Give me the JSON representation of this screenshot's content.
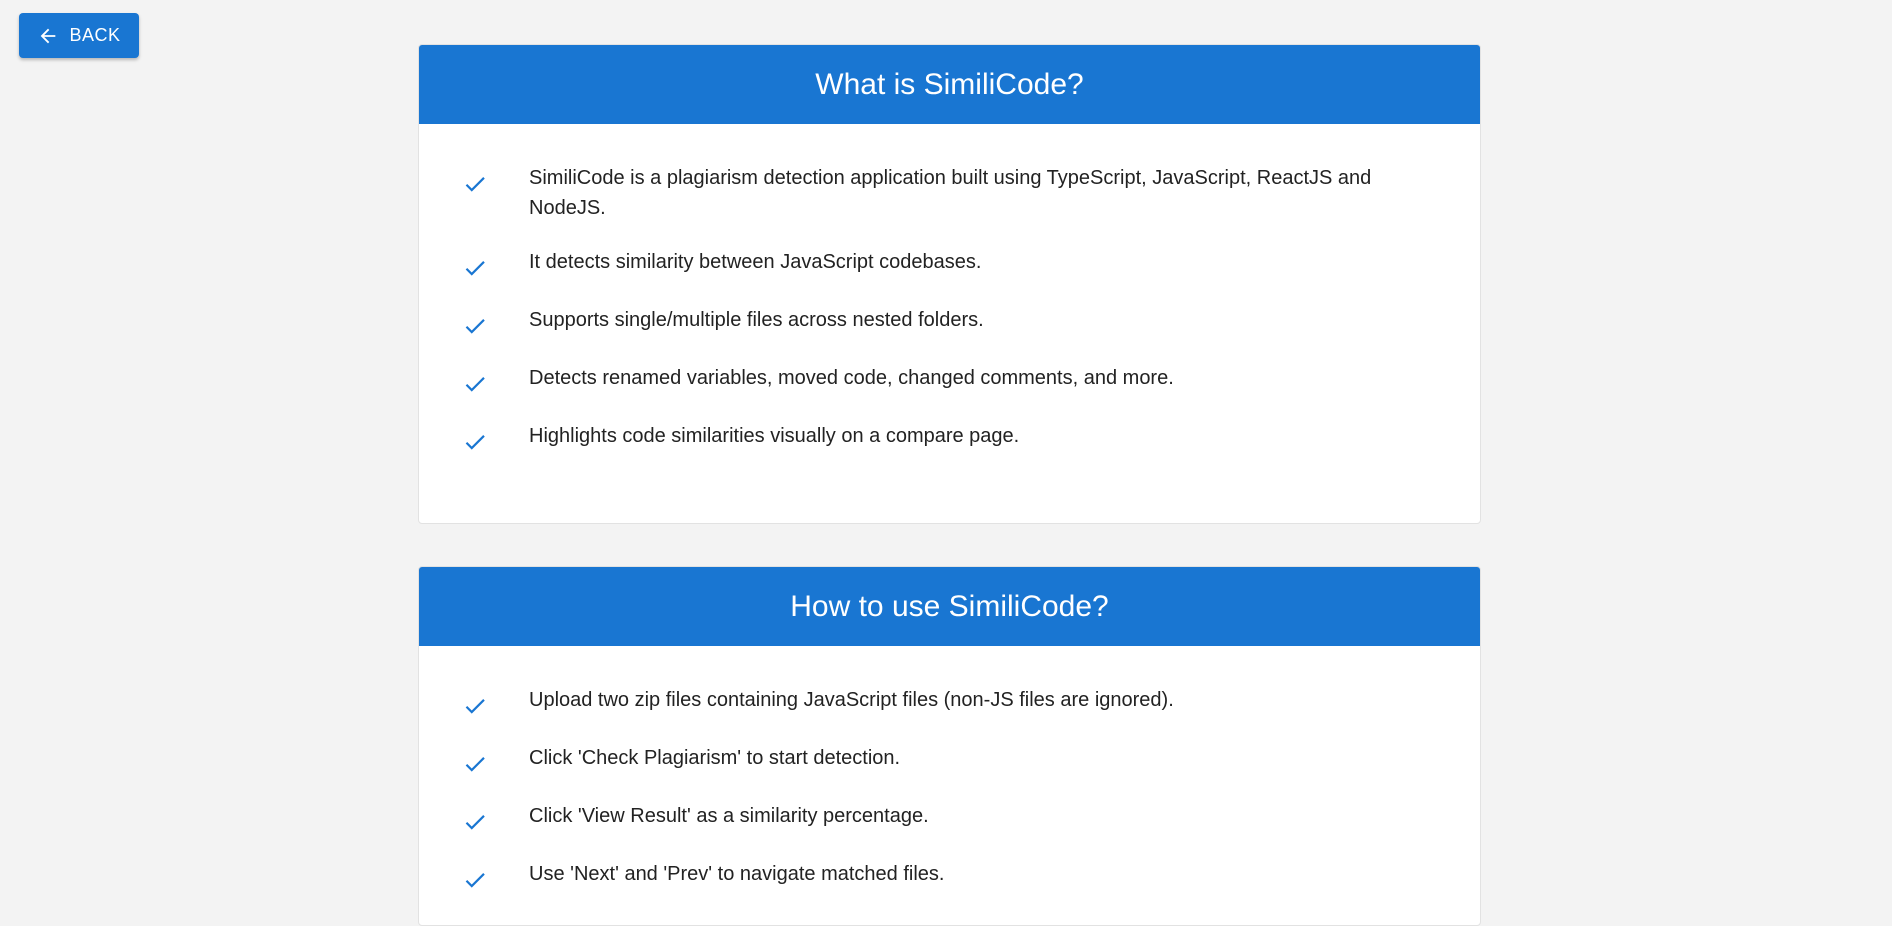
{
  "back_button": {
    "label": "BACK",
    "icon": "arrow-left-icon"
  },
  "colors": {
    "primary": "#1976d2",
    "background": "#f3f3f3",
    "check": "#1976d2"
  },
  "what_card": {
    "title": "What is SimiliCode?",
    "items": [
      {
        "text": "SimiliCode is a plagiarism detection application built using TypeScript, JavaScript, ReactJS and NodeJS."
      },
      {
        "text": "It detects similarity between JavaScript codebases."
      },
      {
        "text": "Supports single/multiple files across nested folders."
      },
      {
        "text": "Detects renamed variables, moved code, changed comments, and more."
      },
      {
        "text": "Highlights code similarities visually on a compare page."
      }
    ]
  },
  "how_card": {
    "title": "How to use SimiliCode?",
    "items": [
      {
        "text": "Upload two zip files containing JavaScript files (non-JS files are ignored)."
      },
      {
        "text": "Click 'Check Plagiarism' to start detection."
      },
      {
        "text": "Click 'View Result' as a similarity percentage."
      },
      {
        "text": "Use 'Next' and 'Prev' to navigate matched files."
      }
    ]
  }
}
